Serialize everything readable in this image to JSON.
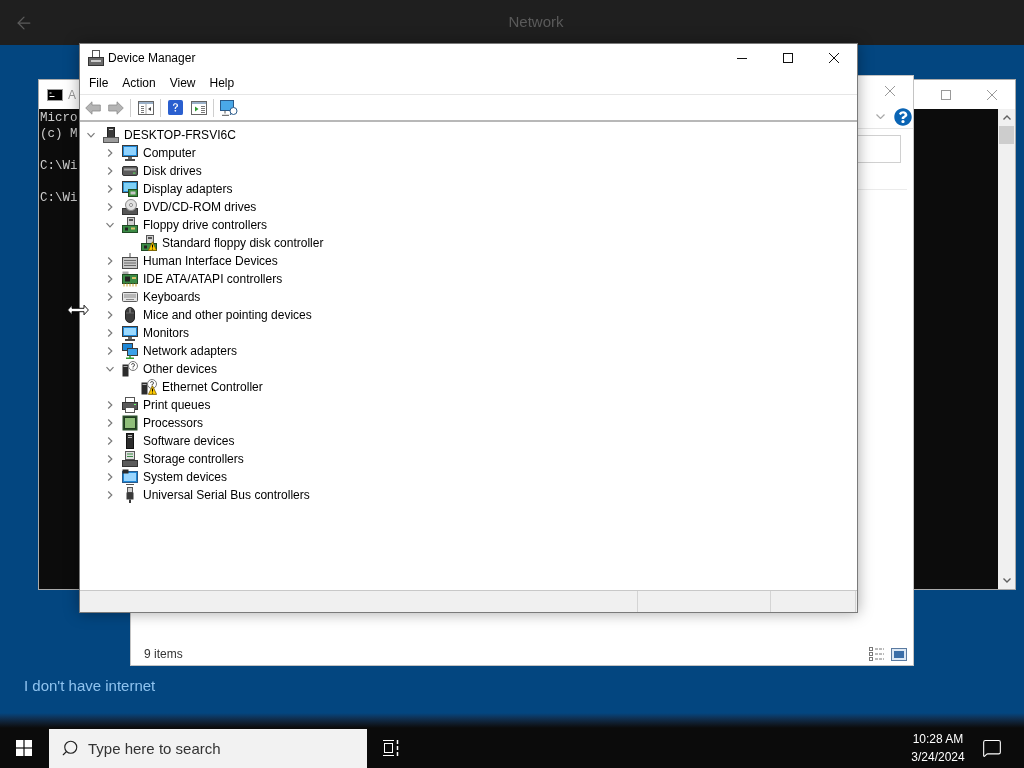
{
  "top_bar": {
    "title": "Network"
  },
  "console_window": {
    "title": "A",
    "active": false,
    "blocks": [
      [
        "Micro",
        "(c) M"
      ],
      [
        "C:\\Wi"
      ],
      [
        "C:\\Wi"
      ]
    ]
  },
  "network_window": {
    "active": false,
    "status": "9 items"
  },
  "device_manager": {
    "title": "Device Manager",
    "active": true,
    "menu": [
      "File",
      "Action",
      "View",
      "Help"
    ],
    "toolbar": {
      "back_disabled": true,
      "forward_disabled": true
    },
    "tree": {
      "label": "DESKTOP-FRSVI6C",
      "expanded": true,
      "children": [
        {
          "label": "Computer",
          "expanded": false,
          "warning": false
        },
        {
          "label": "Disk drives",
          "expanded": false,
          "warning": false
        },
        {
          "label": "Display adapters",
          "expanded": false,
          "warning": false
        },
        {
          "label": "DVD/CD-ROM drives",
          "expanded": false,
          "warning": false
        },
        {
          "label": "Floppy drive controllers",
          "expanded": true,
          "warning": false,
          "children": [
            {
              "label": "Standard floppy disk controller",
              "warning": true
            }
          ]
        },
        {
          "label": "Human Interface Devices",
          "expanded": false,
          "warning": false
        },
        {
          "label": "IDE ATA/ATAPI controllers",
          "expanded": false,
          "warning": false
        },
        {
          "label": "Keyboards",
          "expanded": false,
          "warning": false
        },
        {
          "label": "Mice and other pointing devices",
          "expanded": false,
          "warning": false
        },
        {
          "label": "Monitors",
          "expanded": false,
          "warning": false
        },
        {
          "label": "Network adapters",
          "expanded": false,
          "warning": false
        },
        {
          "label": "Other devices",
          "expanded": true,
          "warning": false,
          "children": [
            {
              "label": "Ethernet Controller",
              "warning": true
            }
          ]
        },
        {
          "label": "Print queues",
          "expanded": false,
          "warning": false
        },
        {
          "label": "Processors",
          "expanded": false,
          "warning": false
        },
        {
          "label": "Software devices",
          "expanded": false,
          "warning": false
        },
        {
          "label": "Storage controllers",
          "expanded": false,
          "warning": false
        },
        {
          "label": "System devices",
          "expanded": false,
          "warning": false
        },
        {
          "label": "Universal Serial Bus controllers",
          "expanded": false,
          "warning": false
        }
      ]
    }
  },
  "link": {
    "label": "I don't have internet"
  },
  "taskbar": {
    "search": {
      "placeholder": "Type here to search"
    },
    "time": "10:28 AM",
    "date": "3/24/2024"
  }
}
